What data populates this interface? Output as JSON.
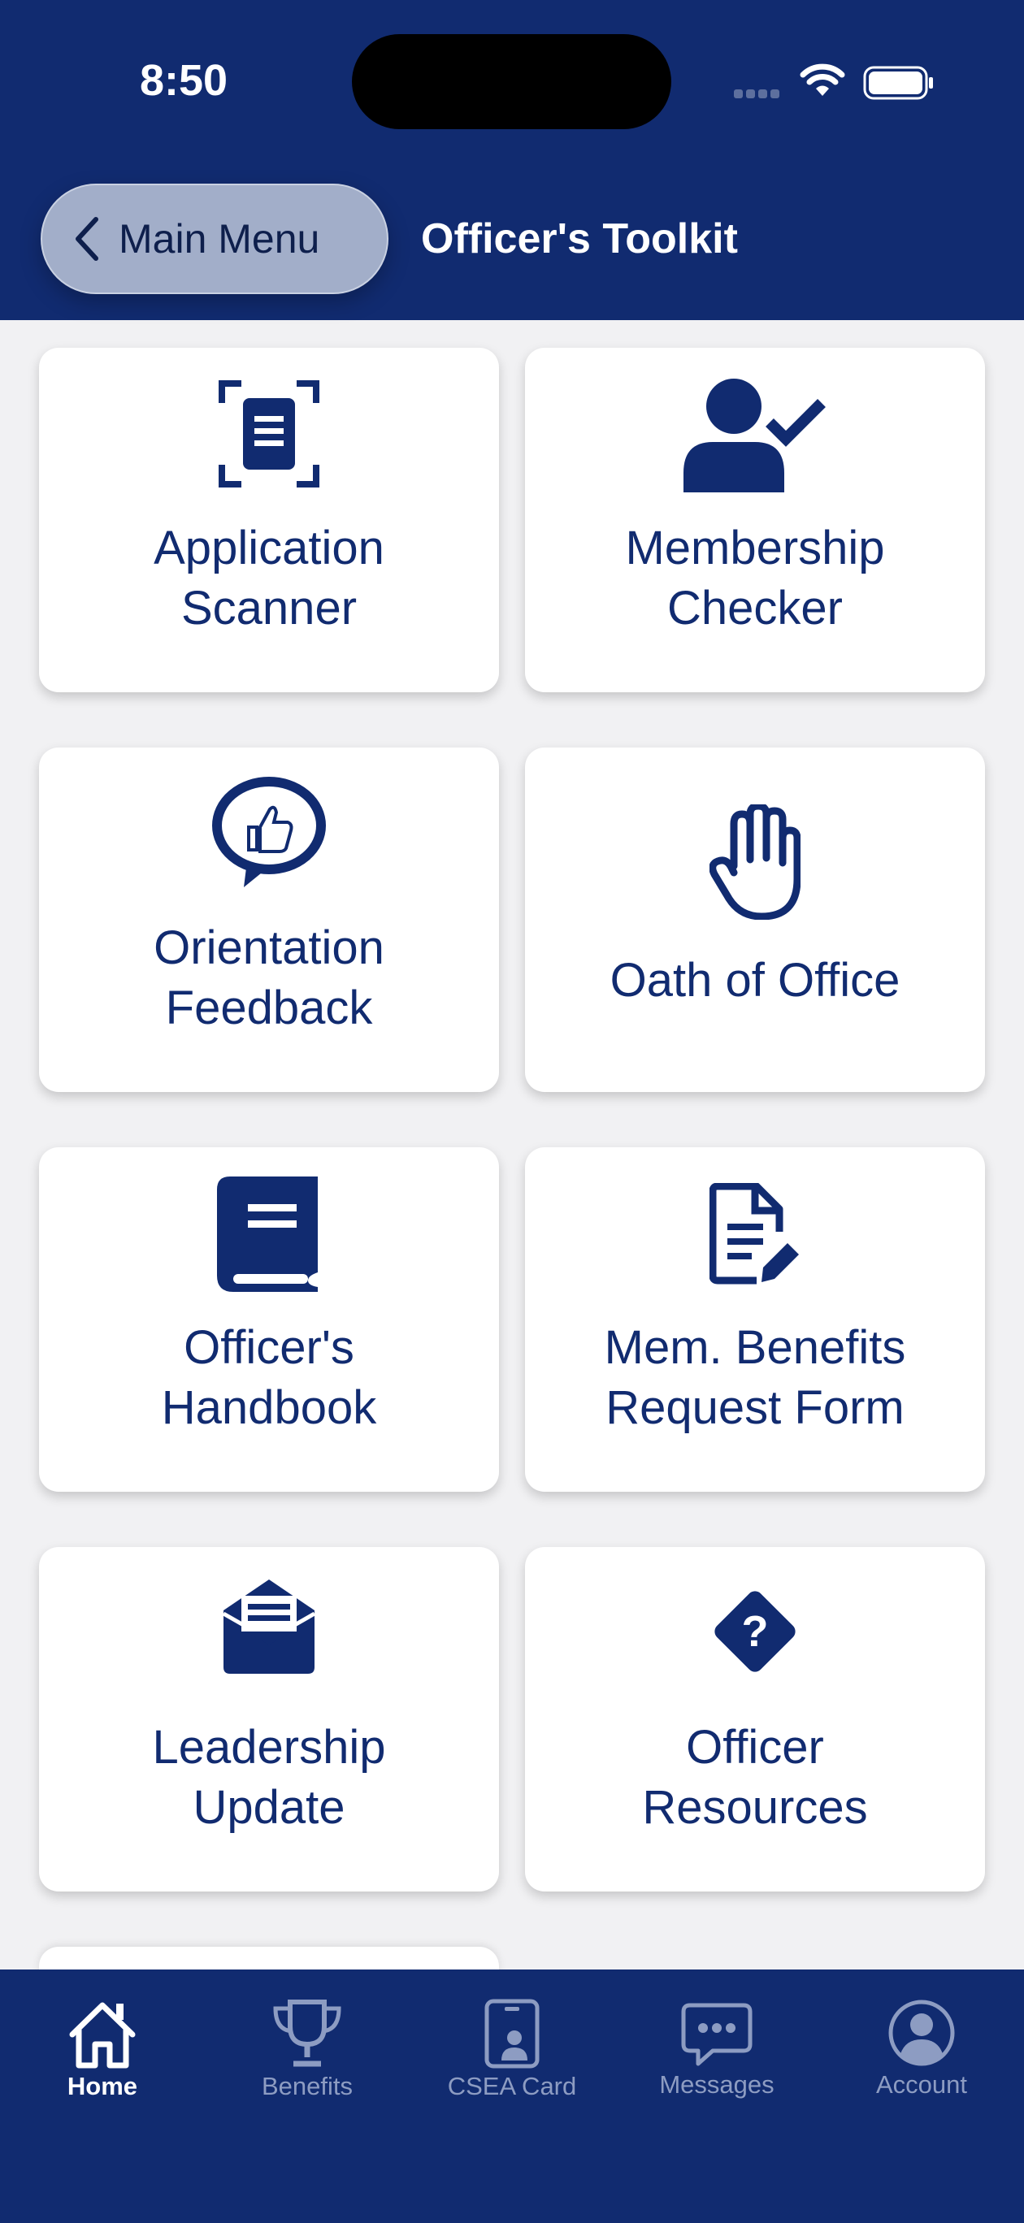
{
  "status_bar": {
    "time": "8:50"
  },
  "nav": {
    "back_label": "Main Menu",
    "title": "Officer's Toolkit"
  },
  "tiles": [
    {
      "line1": "Application",
      "line2": "Scanner",
      "icon": "document-scan-icon"
    },
    {
      "line1": "Membership",
      "line2": "Checker",
      "icon": "user-check-icon"
    },
    {
      "line1": "Orientation",
      "line2": "Feedback",
      "icon": "thumbs-up-speech-icon"
    },
    {
      "line1": "Oath of Office",
      "line2": "",
      "icon": "raised-hand-icon"
    },
    {
      "line1": "Officer's",
      "line2": "Handbook",
      "icon": "book-icon"
    },
    {
      "line1": "Mem. Benefits",
      "line2": "Request Form",
      "icon": "document-edit-icon"
    },
    {
      "line1": "Leadership",
      "line2": "Update",
      "icon": "open-envelope-icon"
    },
    {
      "line1": "Officer",
      "line2": "Resources",
      "icon": "question-diamond-icon"
    }
  ],
  "tabs": [
    {
      "label": "Home",
      "icon": "home-icon",
      "active": true
    },
    {
      "label": "Benefits",
      "icon": "trophy-icon",
      "active": false
    },
    {
      "label": "CSEA Card",
      "icon": "id-card-icon",
      "active": false
    },
    {
      "label": "Messages",
      "icon": "chat-bubble-icon",
      "active": false
    },
    {
      "label": "Account",
      "icon": "account-circle-icon",
      "active": false
    }
  ],
  "colors": {
    "navy": "#112b70",
    "back_button": "#a2aec9",
    "background": "#f1f1f3",
    "inactive_tab": "#8d9cc2"
  }
}
